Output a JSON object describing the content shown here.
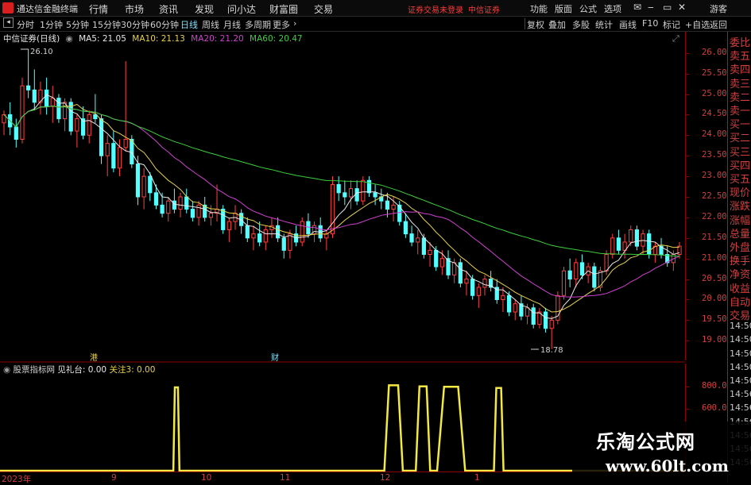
{
  "menu": {
    "app_title": "通达信金融终端",
    "items": [
      "行情",
      "市场",
      "资讯",
      "发现",
      "问小达",
      "财富圈",
      "交易"
    ],
    "status_red": [
      "证券交易未登录",
      "中信证券"
    ],
    "right_items": [
      "功能",
      "版面",
      "公式",
      "选项"
    ],
    "guest": "游客"
  },
  "toolbar": {
    "periods": [
      "分时",
      "1分钟",
      "5分钟",
      "15分钟",
      "30分钟",
      "60分钟",
      "日线",
      "周线",
      "月线",
      "多周期",
      "更多"
    ],
    "active_period": "日线",
    "right_tools": [
      "复权",
      "叠加",
      "多股",
      "统计",
      "画线",
      "F10",
      "标记",
      "+自选",
      "返回"
    ]
  },
  "chart": {
    "stock_title": "中信证券(日线)",
    "ma_labels": [
      {
        "text": "MA5: 21.05",
        "color": "#e8e8e8"
      },
      {
        "text": "MA10: 21.13",
        "color": "#e8d24a"
      },
      {
        "text": "MA20: 21.20",
        "color": "#d040d0"
      },
      {
        "text": "MA60: 20.47",
        "color": "#3ccf3c"
      }
    ],
    "high_marker": "26.10",
    "low_marker": "18.78",
    "event_markers": [
      "港",
      "财"
    ],
    "price_ticks": [
      "26.00",
      "25.50",
      "25.00",
      "24.50",
      "24.00",
      "23.50",
      "23.00",
      "22.50",
      "22.00",
      "21.50",
      "21.00",
      "20.50",
      "20.00",
      "19.50",
      "19.00"
    ],
    "colors": {
      "up": "#ff4040",
      "down": "#54ffff",
      "ma5": "#e8e8e8",
      "ma10": "#e8d24a",
      "ma20": "#d040d0",
      "ma60": "#3ccf3c"
    }
  },
  "indicator": {
    "name": "股票指标网",
    "label1": "见礼台: 0.00",
    "label2": "关注3: 0.00",
    "ticks": [
      "800.0",
      "600.0"
    ]
  },
  "date_axis": [
    "2023年",
    "9",
    "10",
    "11",
    "12",
    "1"
  ],
  "right_panel": {
    "rows": [
      "委比",
      "卖五",
      "卖四",
      "卖三",
      "卖二",
      "卖一",
      "买一",
      "买二",
      "买三",
      "买四",
      "买五",
      "现价",
      "涨跌",
      "涨幅",
      "总量",
      "外盘",
      "换手",
      "净资",
      "收益",
      "自动",
      "交易",
      "14:50",
      "14:50",
      "14:50",
      "14:50",
      "14:50",
      "14:56",
      "14:56",
      "14:56",
      "14:56",
      "14:56",
      "14:56"
    ],
    "corner": "L"
  },
  "watermark": {
    "title": "乐淘公式网",
    "url": "www.60lt.com"
  },
  "chart_data": {
    "type": "candlestick",
    "title": "中信证券(日线)",
    "ylim": [
      18.6,
      26.4
    ],
    "x_range_months": [
      "2023年",
      "9",
      "10",
      "11",
      "12",
      "1"
    ],
    "candles": [
      [
        24.3,
        24.6,
        24.0,
        24.5
      ],
      [
        24.5,
        24.8,
        24.0,
        24.2
      ],
      [
        24.2,
        24.4,
        23.7,
        23.9
      ],
      [
        23.9,
        25.4,
        23.8,
        25.2
      ],
      [
        25.2,
        26.1,
        24.9,
        25.1
      ],
      [
        25.1,
        25.6,
        24.6,
        24.8
      ],
      [
        24.8,
        25.3,
        24.5,
        25.1
      ],
      [
        25.1,
        25.4,
        24.5,
        24.7
      ],
      [
        24.7,
        25.2,
        24.3,
        24.9
      ],
      [
        24.9,
        25.0,
        24.3,
        24.4
      ],
      [
        24.4,
        24.9,
        24.1,
        24.8
      ],
      [
        24.8,
        24.9,
        24.0,
        24.1
      ],
      [
        24.1,
        24.5,
        23.7,
        24.4
      ],
      [
        24.4,
        24.7,
        23.9,
        24.0
      ],
      [
        24.0,
        24.6,
        23.8,
        24.5
      ],
      [
        24.5,
        25.0,
        24.3,
        24.4
      ],
      [
        24.4,
        24.5,
        23.3,
        23.5
      ],
      [
        23.5,
        24.0,
        23.0,
        23.8
      ],
      [
        23.8,
        24.1,
        23.1,
        23.2
      ],
      [
        23.2,
        23.9,
        23.0,
        23.7
      ],
      [
        23.7,
        25.8,
        23.6,
        23.9
      ],
      [
        23.9,
        24.0,
        23.2,
        23.3
      ],
      [
        23.3,
        23.5,
        22.3,
        22.5
      ],
      [
        22.5,
        23.2,
        22.2,
        23.0
      ],
      [
        23.0,
        23.1,
        22.4,
        22.6
      ],
      [
        22.6,
        22.8,
        22.2,
        22.3
      ],
      [
        22.3,
        22.6,
        22.0,
        22.1
      ],
      [
        22.1,
        22.5,
        21.9,
        22.4
      ],
      [
        22.4,
        22.7,
        22.1,
        22.2
      ],
      [
        22.2,
        22.6,
        22.0,
        22.5
      ],
      [
        22.5,
        22.7,
        22.1,
        22.2
      ],
      [
        22.2,
        22.4,
        21.9,
        22.0
      ],
      [
        22.0,
        22.4,
        21.8,
        22.3
      ],
      [
        22.3,
        22.5,
        21.9,
        22.0
      ],
      [
        22.0,
        22.3,
        21.8,
        22.1
      ],
      [
        22.1,
        22.8,
        21.9,
        22.2
      ],
      [
        22.2,
        22.3,
        21.6,
        21.7
      ],
      [
        21.7,
        22.0,
        21.4,
        21.9
      ],
      [
        21.9,
        22.3,
        21.7,
        22.1
      ],
      [
        22.1,
        22.2,
        21.6,
        21.8
      ],
      [
        21.8,
        22.0,
        21.4,
        21.5
      ],
      [
        21.5,
        21.8,
        21.2,
        21.6
      ],
      [
        21.6,
        21.9,
        21.3,
        21.4
      ],
      [
        21.4,
        21.8,
        21.2,
        21.7
      ],
      [
        21.7,
        22.0,
        21.5,
        21.8
      ],
      [
        21.8,
        22.0,
        21.4,
        21.5
      ],
      [
        21.5,
        21.6,
        21.0,
        21.2
      ],
      [
        21.2,
        21.7,
        21.0,
        21.6
      ],
      [
        21.6,
        21.8,
        21.3,
        21.4
      ],
      [
        21.4,
        22.0,
        21.3,
        21.9
      ],
      [
        21.9,
        22.1,
        21.5,
        21.6
      ],
      [
        21.6,
        21.9,
        21.4,
        21.8
      ],
      [
        21.8,
        22.0,
        21.4,
        21.5
      ],
      [
        21.5,
        21.7,
        21.2,
        21.6
      ],
      [
        21.6,
        23.0,
        21.5,
        22.8
      ],
      [
        22.8,
        23.0,
        22.4,
        22.6
      ],
      [
        22.6,
        22.9,
        22.3,
        22.5
      ],
      [
        22.5,
        22.9,
        22.2,
        22.7
      ],
      [
        22.7,
        22.9,
        22.3,
        22.4
      ],
      [
        22.4,
        23.0,
        22.3,
        22.9
      ],
      [
        22.9,
        23.0,
        22.5,
        22.6
      ],
      [
        22.6,
        22.8,
        22.3,
        22.5
      ],
      [
        22.5,
        22.7,
        22.2,
        22.4
      ],
      [
        22.4,
        22.6,
        22.0,
        22.2
      ],
      [
        22.2,
        22.5,
        21.9,
        22.3
      ],
      [
        22.3,
        22.4,
        21.8,
        21.9
      ],
      [
        21.9,
        22.1,
        21.5,
        21.6
      ],
      [
        21.6,
        21.8,
        21.3,
        21.4
      ],
      [
        21.4,
        21.7,
        21.1,
        21.5
      ],
      [
        21.5,
        21.6,
        21.0,
        21.1
      ],
      [
        21.1,
        21.4,
        20.8,
        21.2
      ],
      [
        21.2,
        21.3,
        20.7,
        20.8
      ],
      [
        20.8,
        21.2,
        20.6,
        21.0
      ],
      [
        21.0,
        21.2,
        20.5,
        20.6
      ],
      [
        20.6,
        21.0,
        20.4,
        20.9
      ],
      [
        20.9,
        21.0,
        20.3,
        20.4
      ],
      [
        20.4,
        20.7,
        20.1,
        20.5
      ],
      [
        20.5,
        20.6,
        20.0,
        20.1
      ],
      [
        20.1,
        20.4,
        19.8,
        20.3
      ],
      [
        20.3,
        20.6,
        20.1,
        20.5
      ],
      [
        20.5,
        20.7,
        20.2,
        20.3
      ],
      [
        20.3,
        20.5,
        19.9,
        20.0
      ],
      [
        20.0,
        20.3,
        19.7,
        20.1
      ],
      [
        20.1,
        20.2,
        19.6,
        19.7
      ],
      [
        19.7,
        20.0,
        19.5,
        19.9
      ],
      [
        19.9,
        20.1,
        19.5,
        19.6
      ],
      [
        19.6,
        19.9,
        19.4,
        19.8
      ],
      [
        19.8,
        19.9,
        19.3,
        19.4
      ],
      [
        19.4,
        19.8,
        19.3,
        19.7
      ],
      [
        19.7,
        19.8,
        19.2,
        19.3
      ],
      [
        19.3,
        19.6,
        18.8,
        19.5
      ],
      [
        19.5,
        20.2,
        19.4,
        20.1
      ],
      [
        20.1,
        20.8,
        20.0,
        20.7
      ],
      [
        20.7,
        21.0,
        20.3,
        20.5
      ],
      [
        20.5,
        21.0,
        20.3,
        20.9
      ],
      [
        20.9,
        21.1,
        20.5,
        20.6
      ],
      [
        20.6,
        20.9,
        20.4,
        20.8
      ],
      [
        20.8,
        20.9,
        20.2,
        20.3
      ],
      [
        20.3,
        20.8,
        20.2,
        20.7
      ],
      [
        20.7,
        21.2,
        20.6,
        21.1
      ],
      [
        21.1,
        21.6,
        21.0,
        21.5
      ],
      [
        21.5,
        21.7,
        21.1,
        21.2
      ],
      [
        21.2,
        21.6,
        21.0,
        21.4
      ],
      [
        21.4,
        21.8,
        21.3,
        21.7
      ],
      [
        21.7,
        21.8,
        21.2,
        21.3
      ],
      [
        21.3,
        21.7,
        21.1,
        21.6
      ],
      [
        21.6,
        21.7,
        21.0,
        21.1
      ],
      [
        21.1,
        21.4,
        20.9,
        21.3
      ],
      [
        21.3,
        21.5,
        21.0,
        21.1
      ],
      [
        21.1,
        21.3,
        20.8,
        20.9
      ],
      [
        20.9,
        21.2,
        20.7,
        21.1
      ],
      [
        21.1,
        21.4,
        21.0,
        21.3
      ]
    ],
    "indicator_pulses": [
      {
        "start": 0.253,
        "end": 0.262,
        "value": 800
      },
      {
        "start": 0.561,
        "end": 0.588,
        "value": 820
      },
      {
        "start": 0.607,
        "end": 0.628,
        "value": 810
      },
      {
        "start": 0.638,
        "end": 0.679,
        "value": 805
      },
      {
        "start": 0.721,
        "end": 0.735,
        "value": 795
      }
    ]
  }
}
